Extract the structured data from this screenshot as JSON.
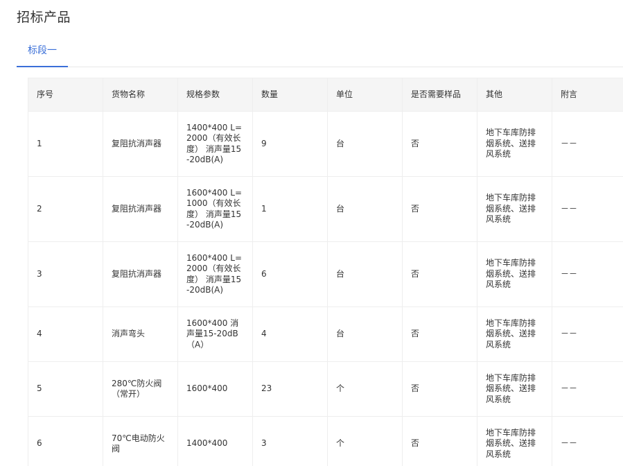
{
  "page": {
    "title": "招标产品"
  },
  "tabs": [
    {
      "label": "标段一",
      "active": true
    }
  ],
  "table": {
    "headers": [
      "序号",
      "货物名称",
      "规格参数",
      "数量",
      "单位",
      "是否需要样品",
      "其他",
      "附言"
    ],
    "rows": [
      [
        "1",
        "复阻抗消声器",
        "1400*400 L=2000（有效长度） 消声量15-20dB(A)",
        "9",
        "台",
        "否",
        "地下车库防排烟系统、送排风系统",
        "－－"
      ],
      [
        "2",
        "复阻抗消声器",
        "1600*400 L=1000（有效长度） 消声量15-20dB(A)",
        "1",
        "台",
        "否",
        "地下车库防排烟系统、送排风系统",
        "－－"
      ],
      [
        "3",
        "复阻抗消声器",
        "1600*400 L=2000（有效长度） 消声量15-20dB(A)",
        "6",
        "台",
        "否",
        "地下车库防排烟系统、送排风系统",
        "－－"
      ],
      [
        "4",
        "消声弯头",
        "1600*400 消声量15-20dB（A）",
        "4",
        "台",
        "否",
        "地下车库防排烟系统、送排风系统",
        "－－"
      ],
      [
        "5",
        "280℃防火阀（常开）",
        "1600*400",
        "23",
        "个",
        "否",
        "地下车库防排烟系统、送排风系统",
        "－－"
      ],
      [
        "6",
        "70℃电动防火阀",
        "1400*400",
        "3",
        "个",
        "否",
        "地下车库防排烟系统、送排风系统",
        "－－"
      ]
    ]
  },
  "colors": {
    "accent": "#3a6fd8",
    "header_bg": "#f5f5f5",
    "border": "#eeeeee"
  }
}
